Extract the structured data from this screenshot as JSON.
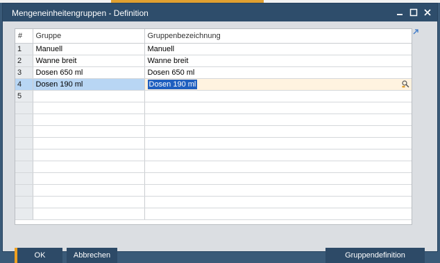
{
  "window": {
    "title": "Mengeneinheitengruppen - Definition",
    "controls": [
      "minimize",
      "maximize",
      "close"
    ]
  },
  "grid": {
    "columns": [
      "#",
      "Gruppe",
      "Gruppenbezeichnung"
    ],
    "rows": [
      {
        "num": "1",
        "gruppe": "Manuell",
        "bezeichnung": "Manuell"
      },
      {
        "num": "2",
        "gruppe": "Wanne breit",
        "bezeichnung": "Wanne breit"
      },
      {
        "num": "3",
        "gruppe": "Dosen 650 ml",
        "bezeichnung": "Dosen 650 ml"
      },
      {
        "num": "4",
        "gruppe": "Dosen 190 ml",
        "bezeichnung": "Dosen 190 ml"
      },
      {
        "num": "5",
        "gruppe": "",
        "bezeichnung": ""
      }
    ],
    "active_row": 4
  },
  "buttons": {
    "ok": "OK",
    "cancel": "Abbrechen",
    "group_definition": "Gruppendefinition"
  },
  "colors": {
    "titlebar": "#2e4d6b",
    "button": "#2d4a67",
    "accent": "#f0a020",
    "selection": "#1f5fbf"
  }
}
